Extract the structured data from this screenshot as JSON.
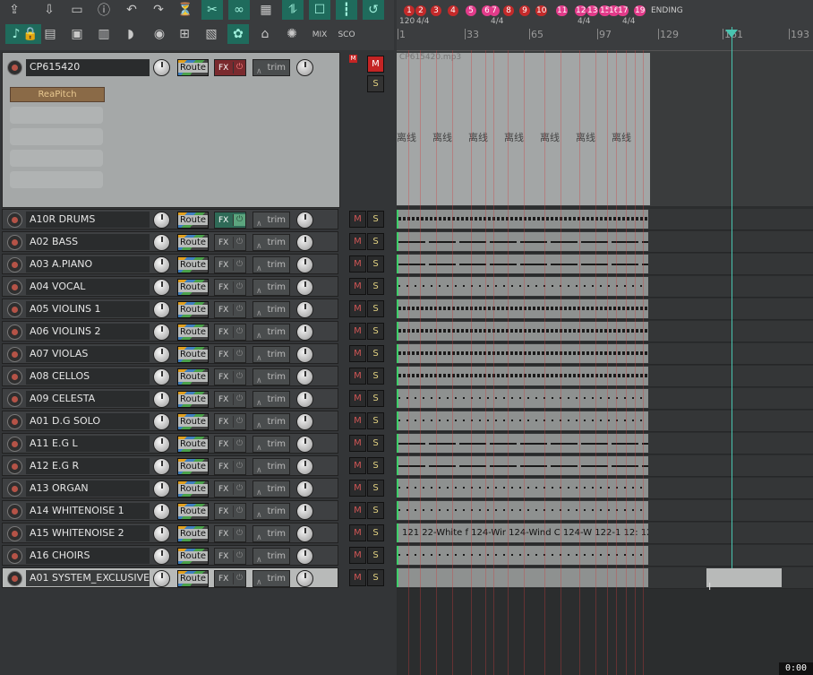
{
  "toolbar": {
    "row1": [
      "new-project-icon",
      "open-project-icon",
      "save-project-icon",
      "info-icon",
      "undo-icon",
      "redo-icon",
      "metronome-icon",
      "snap-icon",
      "link-icon",
      "grid-icon",
      "ripple-icon",
      "track-items-icon",
      "grid-lines-icon",
      "loop-icon",
      "record-icon"
    ],
    "row2": [
      "tuning-fork-icon",
      "lock-icon",
      "piano-roll-icon",
      "mixer-icon",
      "spectrum-icon",
      "duck-icon",
      "render-icon",
      "routing-matrix-icon",
      "channel-icon",
      "film-reel-icon",
      "tape-icon",
      "paint-icon"
    ],
    "mix_label": "MIX",
    "score_label": "SCO"
  },
  "master": {
    "name": "CP615420",
    "route_label": "Route",
    "fx_label": "FX",
    "trim_label": "trim",
    "m_label": "M",
    "s_label": "S",
    "plugin": "ReaPitch",
    "item_label": "CP615420.mp3",
    "item_text": "离线",
    "item_text_repeats": 7
  },
  "tracks": [
    {
      "name": "A10R DRUMS",
      "fx_active": true,
      "pattern": "dense"
    },
    {
      "name": "A02  BASS",
      "fx_active": false,
      "pattern": "line"
    },
    {
      "name": "A03  A.PIANO",
      "fx_active": false,
      "pattern": "line"
    },
    {
      "name": "A04  VOCAL",
      "fx_active": false,
      "pattern": "sparse"
    },
    {
      "name": "A05  VIOLINS 1",
      "fx_active": false,
      "pattern": "dense"
    },
    {
      "name": "A06  VIOLINS 2",
      "fx_active": false,
      "pattern": "dense"
    },
    {
      "name": "A07  VIOLAS",
      "fx_active": false,
      "pattern": "dense"
    },
    {
      "name": "A08  CELLOS",
      "fx_active": false,
      "pattern": "dense"
    },
    {
      "name": "A09  CELESTA",
      "fx_active": false,
      "pattern": "sparse"
    },
    {
      "name": "A01  D.G SOLO",
      "fx_active": false,
      "pattern": "sparse"
    },
    {
      "name": "A11  E.G L",
      "fx_active": false,
      "pattern": "line"
    },
    {
      "name": "A12  E.G R",
      "fx_active": false,
      "pattern": "line"
    },
    {
      "name": "A13  ORGAN",
      "fx_active": false,
      "pattern": "sparse"
    },
    {
      "name": "A14  WHITENOISE 1",
      "fx_active": false,
      "pattern": "sparse"
    },
    {
      "name": "A15  WHITENOISE 2",
      "fx_active": false,
      "pattern": "labels"
    },
    {
      "name": "A16  CHOIRS",
      "fx_active": false,
      "pattern": "sparse"
    },
    {
      "name": "A01  SYSTEM_EXCLUSIVE",
      "fx_active": false,
      "pattern": "empty",
      "selected": true
    }
  ],
  "track_labels": {
    "route": "Route",
    "fx": "FX",
    "trim": "trim",
    "m": "M",
    "s": "S",
    "power": "⏻"
  },
  "ruler": {
    "markers": [
      "1",
      "2",
      "3",
      "4",
      "5",
      "6",
      "7",
      "8",
      "9",
      "10",
      "11",
      "12",
      "13",
      "15",
      "16",
      "17",
      "19"
    ],
    "ending_label": "ENDING",
    "tempo": "120",
    "time_sigs": [
      "4/4",
      "4/4",
      "4/4",
      "4/4"
    ],
    "bar_numbers": [
      "1",
      "33",
      "65",
      "97",
      "129",
      "161",
      "193"
    ]
  },
  "whitenoise2_item_text": "121 22-White f 124-Wir 124-Wind C 124-W 122-1 12: 124-W",
  "clock": "0:00",
  "colors": {
    "marker_red": "#c42a2a",
    "marker_pink": "#e23b8a",
    "teal": "#49c4b0",
    "item_gray": "#8e9190"
  }
}
